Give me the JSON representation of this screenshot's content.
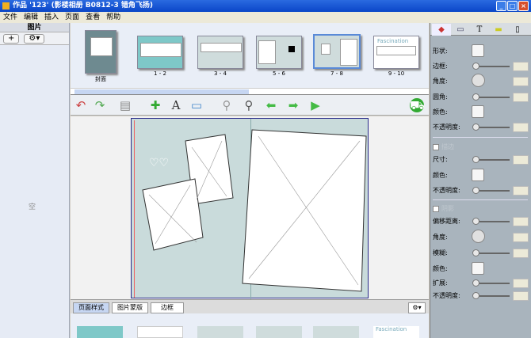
{
  "window": {
    "title": "作品 '123' (影楼相册 B0812-3 错角飞扬)"
  },
  "menu": [
    "文件",
    "编辑",
    "插入",
    "页面",
    "查看",
    "帮助"
  ],
  "left_panel": {
    "title": "图片",
    "add_label": "+",
    "settings_label": "⚙▾",
    "empty_text": "空"
  },
  "thumbnails": [
    {
      "label": "封面"
    },
    {
      "label": "1 - 2"
    },
    {
      "label": "3 - 4"
    },
    {
      "label": "5 - 6"
    },
    {
      "label": "7 - 8",
      "selected": true
    },
    {
      "label": "9 - 10",
      "title": "Fascination"
    }
  ],
  "toolbar": [
    "undo-icon",
    "redo-icon",
    "delete-icon",
    "add-image-icon",
    "add-text-icon",
    "add-page-icon",
    "zoom-out-icon",
    "zoom-in-icon",
    "prev-arrow-icon",
    "next-arrow-icon",
    "play-icon",
    "cart-icon"
  ],
  "bottom_tabs": [
    "页面样式",
    "图片蒙版",
    "边框"
  ],
  "bottom_thumb_title": "Fascination",
  "right_panel": {
    "section1": {
      "shape": "形状:",
      "border": "边框:",
      "angle": "角度:",
      "corner": "圆角:",
      "color": "颜色:",
      "opacity": "不透明度:"
    },
    "section2": {
      "checkbox": "描边",
      "size": "尺寸:",
      "color": "颜色:",
      "opacity": "不透明度:"
    },
    "section3": {
      "checkbox": "阴影",
      "offset": "偏移距离:",
      "angle": "角度:",
      "blur": "模糊:",
      "color": "颜色:",
      "spread": "扩展:",
      "opacity": "不透明度:"
    }
  }
}
